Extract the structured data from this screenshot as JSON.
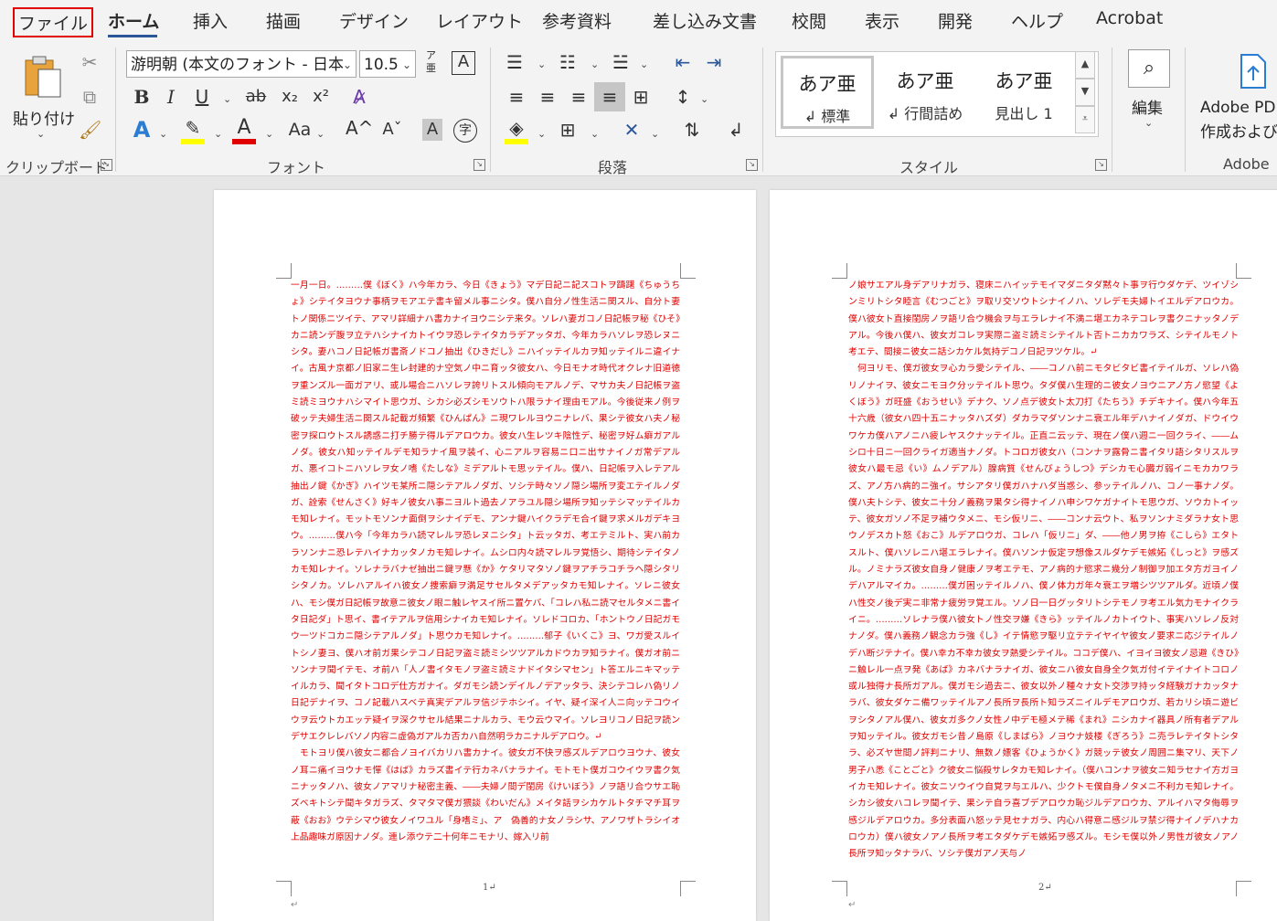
{
  "tabs": [
    "ファイル",
    "ホーム",
    "挿入",
    "描画",
    "デザイン",
    "レイアウト",
    "参考資料",
    "差し込み文書",
    "校閲",
    "表示",
    "開発",
    "ヘルプ",
    "Acrobat"
  ],
  "ribbon": {
    "clipboard": {
      "paste": "貼り付け",
      "label": "クリップボード"
    },
    "font": {
      "name": "游明朝 (本文のフォント - 日本",
      "size": "10.5",
      "label": "フォント",
      "bold": "B",
      "italic": "I",
      "underline": "U",
      "strike": "ab",
      "subscript": "x₂",
      "superscript": "x²",
      "case": "Aa",
      "grow": "A^",
      "shrink": "Aˇ",
      "shade": "A",
      "enclose": "字",
      "phonetic": "ア亜"
    },
    "paragraph": {
      "label": "段落"
    },
    "styles": {
      "label": "スタイル",
      "items": [
        {
          "sample": "あア亜",
          "name": "↲ 標準"
        },
        {
          "sample": "あア亜",
          "name": "↲ 行間詰め"
        },
        {
          "sample": "あア亜",
          "name": "見出し 1"
        }
      ]
    },
    "editing": {
      "label": "編集"
    },
    "adobe": {
      "line1": "Adobe PD",
      "line2": "作成および共",
      "label": "Adobe"
    }
  },
  "pages": [
    {
      "number": "1↵",
      "text": "一月一日。………僕《ぼく》ハ今年カラ、今日《きょう》マデ日記ニ記スコトヲ躊躇《ちゅうちょ》シテイタヨウナ事柄ヲモアエテ書キ留メル事ニシタ。僕ハ自分ノ性生活ニ関スル、自分ト妻トノ関係ニツイテ、アマリ詳細ナハ書カナイヨウニシテ来タ。ソレハ妻ガコノ日記帳ヲ秘《ひそ》カニ読ンデ腹ヲ立テハシナイカトイウヲ恐レテイタカラデアッタガ、今年カラハソレヲ恐レヌニシタ。妻ハコノ日記帳ガ書斎ノドコノ抽出《ひきだし》ニハイッテイルカヲ知ッテイルニ違イナイ。古風ナ京都ノ旧家ニ生レ封建的ナ空気ノ中ニ育ッタ彼女ハ、今日モナオ時代オクレナ旧道徳ヲ重ンズル一面ガアリ、或ル場合ニハソレヲ誇リトスル傾向モアルノデ、マサカ夫ノ日記帳ヲ盗ミ読ミヨウナハシマイト思ウガ、シカシ必ズシモソウトハ限ラナイ理由モアル。今後従来ノ例ヲ破ッテ夫婦生活ニ関スル記載ガ頻繁《ひんぱん》ニ現ワレルヨウニナレバ、果シテ彼女ハ夫ノ秘密ヲ探ロウトスル誘惑ニ打チ勝テ得ルデアロウカ。彼女ハ生レツキ陰性デ、秘密ヲ好ム癖ガアルノダ。彼女ハ知ッテイルデモ知ラナイ風ヲ装イ、心ニアルヲ容易ニ口ニ出サナイノガ常デアルガ、悪イコトニハソレヲ女ノ嗜《たしな》ミデアルトモ思ッテイル。僕ハ、日記帳ヲ入レテアル抽出ノ鍵《かぎ》ハイツモ某所ニ隠シテアルノダガ、ソシテ時々ソノ隠シ場所ヲ変エテイルノダガ、詮索《せんさく》好キノ彼女ハ事ニヨルト過去ノアラユル隠シ場所ヲ知ッテシマッテイルカモ知レナイ。モットモソンナ面倒ヲシナイデモ、アンナ鍵ハイクラデモ合イ鍵ヲ求メルガデキヨウ。………僕ハ今「今年カラハ読マレルヲ恐レヌニシタ」ト云ッタガ、考エテミルト、実ハ前カラソンナニ恐レテハイナカッタノカモ知レナイ。ムシロ内々読マレルヲ覚悟シ、期待シテイタノカモ知レナイ。ソレナラバナゼ抽出ニ鍵ヲ懸《か》ケタリマタソノ鍵ヲアチラコチラヘ隠シタリシタノカ。ソレハアルイハ彼女ノ捜索癖ヲ満足サセルタメデアッタカモ知レナイ。ソレニ彼女ハ、モシ僕ガ日記帳ヲ故意ニ彼女ノ眼ニ触レヤスイ所ニ置ケバ、「コレハ私ニ読マセルタメニ書イタ日記ダ」ト思イ、書イテアルヲ信用シナイカモ知レナイ。ソレドコロカ、「ホントウノ日記ガモウ一ツドコカニ隠シテアルノダ」ト思ウカモ知レナイ。………郁子《いくこ》ヨ、ワガ愛スルイトシノ妻ヨ、僕ハオ前ガ果シテコノ日記ヲ盗ミ読ミシツツアルカドウカヲ知ラナイ。僕ガオ前ニソンナヲ聞イテモ、オ前ハ「人ノ書イタモノヲ盗ミ読ミナドイタシマセン」ト答エルニキマッテイルカラ、聞イタトコロデ仕方ガナイ。ダガモシ読ンデイルノデアッタラ、決シテコレハ偽リノ日記デナイヲ、コノ記載ハスベテ真実デアルヲ信ジテホシイ。イヤ、疑イ深イ人ニ向ッテコウイウヲ云ウトカエッテ疑イヲ深クサセル結果ニナルカラ、モウ云ウマイ。ソレヨリコノ日記ヲ読ンデサエクレレバソノ内容ニ虚偽ガアルカ否カハ自然明ラカニナルデアロウ。↵\n　モトヨリ僕ハ彼女ニ都合ノヨイバカリハ書カナイ。彼女ガ不快ヲ感ズルデアロウヨウナ、彼女ノ耳ニ痛イヨウナモ憚《はば》カラズ書イテ行カネバナラナイ。モトモト僕ガコウイウヲ書ク気ニナッタノハ、彼女ノアマリナ秘密主義、――夫婦ノ間デ閨房《けいぼう》ノヲ語リ合ウサエ恥ズベキトシテ聞キタガラズ、タマタマ僕ガ猥談《わいだん》メイタ話ヲシカケルトタチマチ耳ヲ蔽《おお》ウテシマウ彼女ノイワユル「身嗜ミ」、ア　偽善的ナ女ノラシサ、アノワザトラシイオ上品趣味ガ原因ナノダ。連レ添ウテ二十何年ニモナリ、嫁入リ前"
    },
    {
      "number": "2↵",
      "text": "ノ娘サエアル身デアリナガラ、寝床ニハイッテモイマダニタダ黙々ト事ヲ行ウダケデ、ツイゾシンミリトシタ睦言《むつごと》ヲ取リ交ソウトシナイノハ、ソレデモ夫婦トイエルデアロウカ。僕ハ彼女ト直接閨房ノヲ語リ合ウ機会ヲ与エラレナイ不満ニ堪エカネテコレヲ書クニナッタノデアル。今後ハ僕ハ、彼女ガコレヲ実際ニ盗ミ読ミシテイルト否トニカカワラズ、シテイルモノト考エテ、間接ニ彼女ニ話シカケル気持デコノ日記ヲツケル。↵\n　何ヨリモ、僕ガ彼女ヲ心カラ愛シテイル、――コノハ前ニモタビタビ書イテイルガ、ソレハ偽リノナイヲ、彼女ニモヨク分ッテイルト思ウ。タダ僕ハ生理的ニ彼女ノヨウニアノ方ノ慾望《よくぼう》ガ旺盛《おうせい》デナク、ソノ点デ彼女ト太刀打《たちう》チデキナイ。僕ハ今年五十六歳（彼女ハ四十五ニナッタハズダ）ダカラマダソンナニ衰エル年デハナイノダガ、ドウイウワケカ僕ハアノニハ疲レヤスクナッテイル。正直ニ云ッテ、現在ノ僕ハ週ニ一回クライ、――ムシロ十日ニ一回クライガ適当ナノダ。トコロガ彼女ハ（コンナヲ露骨ニ書イタリ語シタリスルヲ彼女ハ最モ忌《い》ムノデアル）腺病質《せんびょうしつ》デシカモ心臓ガ弱イニモカカワラズ、アノ方ハ病的ニ強イ。サシアタリ僕ガハナハダ当惑シ、参ッテイルノハ、コノ一事ナノダ。僕ハ夫トシテ、彼女ニ十分ノ義務ヲ果タシ得ナイノハ申シワケガナイトモ思ウガ、ソウカトイッテ、彼女ガソノ不足ヲ補ウタメニ、モシ仮リニ、――コンナ云ウト、私ヲソンナミダラナ女ト思ウノデスカト怒《おこ》ルデアロウガ、コレハ「仮リニ」ダ、――他ノ男ヲ拵《こしら》エタトスルト、僕ハソレニハ堪エラレナイ。僕ハソンナ仮定ヲ想像スルダケデモ嫉妬《しっと》ヲ感ズル。ノミナラズ彼女自身ノ健康ノヲ考エテモ、アノ病的ナ慾求ニ幾分ノ制御ヲ加エタ方ガヨイノデハアルマイカ。………僕ガ困ッテイルノハ、僕ノ体力ガ年々衰エヲ増シツツアルダ。近頃ノ僕ハ性交ノ後デ実ニ非常ナ疲労ヲ覚エル。ソノ日一日グッタリトシテモノヲ考エル気力モナイクライニ。………ソレナラ僕ハ彼女トノ性交ヲ嫌《きら》ッテイルノカトイウト、事実ハソレノ反対ナノダ。僕ハ義務ノ観念カラ強《し》イテ情慾ヲ駆リ立テテイヤイヤ彼女ノ要求ニ応ジテイルノデハ断ジテナイ。僕ハ幸カ不幸カ彼女ヲ熱愛シテイル。ココデ僕ハ、イヨイヨ彼女ノ忌避《きひ》ニ触レル一点ヲ発《あば》カネバナラナイガ、彼女ニハ彼女自身全ク気ガ付イテイナイトコロノ或ル独得ナ長所ガアル。僕ガモシ過去ニ、彼女以外ノ種々ナ女ト交渉ヲ持ッタ経験ガナカッタナラバ、彼女ダケニ備ワッテイルアノ長所ヲ長所ト知ラズニイルデモアロウガ、若カリシ頃ニ遊ビヲシタノアル僕ハ、彼女ガ多クノ女性ノ中デモ極メテ稀《まれ》ニシカナイ器具ノ所有者デアルヲ知ッテイル。彼女ガモシ昔ノ島原《しまばら》ノヨウナ妓楼《ぎろう》ニ売ラレテイタトシタラ、必ズヤ世間ノ評判ニナリ、無数ノ嫖客《ひょうかく》ガ競ッテ彼女ノ周囲ニ集マリ、天下ノ男子ハ悉《ことごと》ク彼女ニ悩殺サレタカモ知レナイ。（僕ハコンナヲ彼女ニ知ラセナイ方ガヨイカモ知レナイ。彼女ニソウイウ自覚ヲ与エルハ、少クトモ僕自身ノタメニ不利カモ知レナイ。シカシ彼女ハコレヲ聞イテ、果シテ自ラ喜ブデアロウカ恥ジルデアロウカ、アルイハマタ侮辱ヲ感ジルデアロウカ。多分表面ハ怒ッテ見セナガラ、内心ハ得意ニ感ジルヲ禁ジ得ナイノデハナカロウカ）僕ハ彼女ノアノ長所ヲ考エタダケデモ嫉妬ヲ感ズル。モシモ僕以外ノ男性ガ彼女ノアノ長所ヲ知ッタナラバ、ソシテ僕ガアノ天与ノ"
    }
  ]
}
